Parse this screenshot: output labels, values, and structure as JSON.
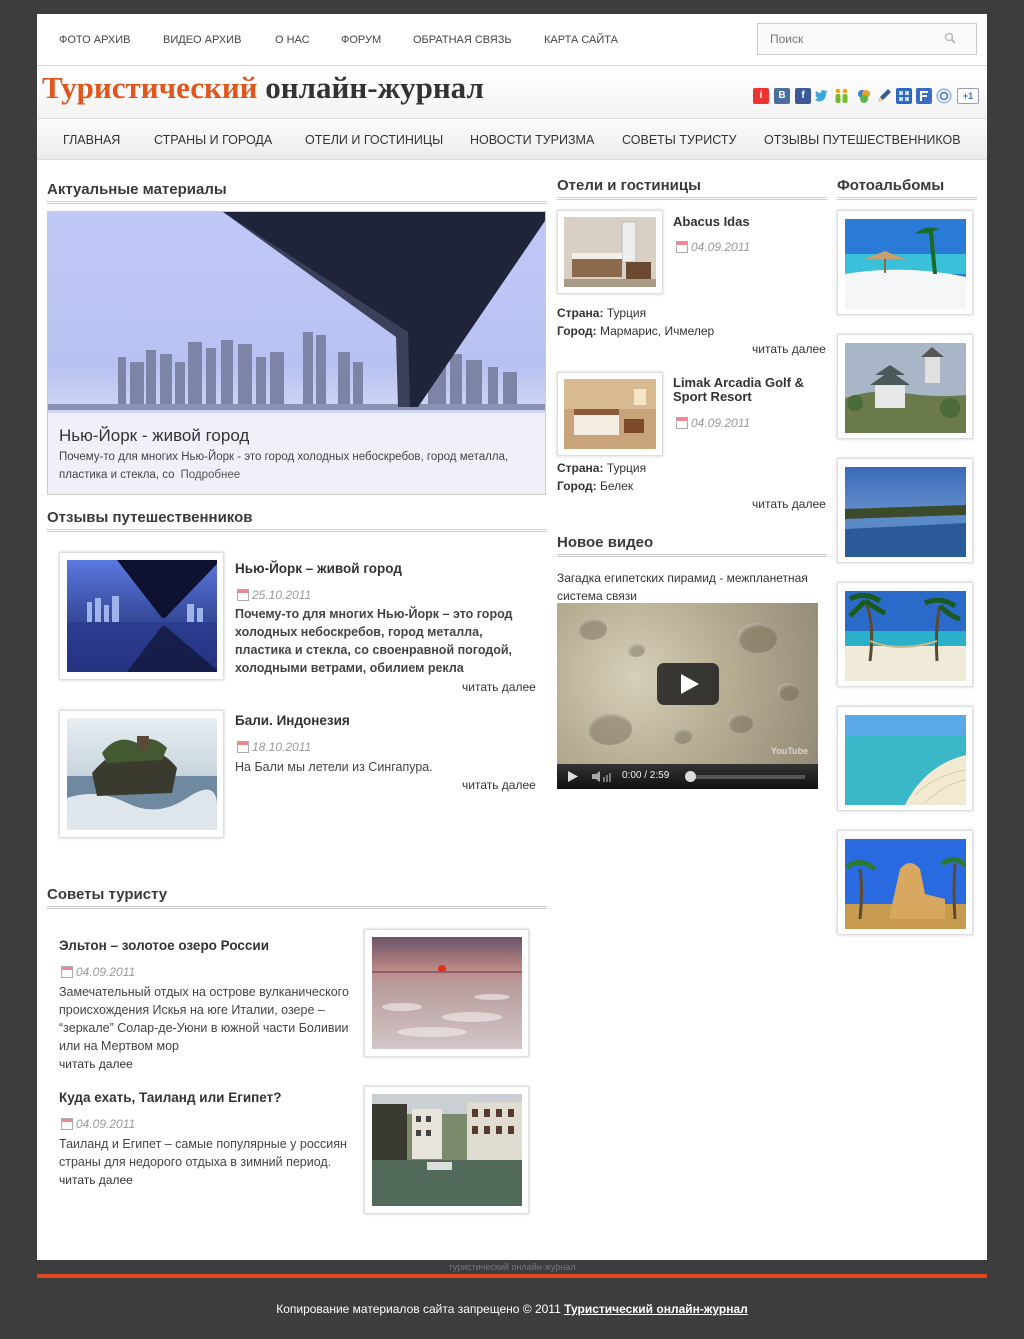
{
  "top_nav": {
    "items": [
      "ФОТО АРХИВ",
      "ВИДЕО АРХИВ",
      "О НАС",
      "ФОРУМ",
      "ОБРАТНАЯ СВЯЗЬ",
      "КАРТА САЙТА"
    ],
    "search_placeholder": "Поиск",
    "search_icon": "magnifier-icon"
  },
  "header": {
    "logo_part1": "Туристический",
    "logo_part2": "онлайн-журнал",
    "social_icons": [
      "ya-icon",
      "vkontakte-icon",
      "facebook-icon",
      "twitter-icon",
      "odnoklassniki-icon",
      "mail-icon",
      "livejournal-icon",
      "bookmarks-icon",
      "friendfeed-icon",
      "google-icon",
      "google-plus-one-icon"
    ],
    "social_labels": {
      "vk": "В",
      "fb": "f",
      "plus": "+1"
    }
  },
  "main_nav": {
    "items": [
      "ГЛАВНАЯ",
      "СТРАНЫ И ГОРОДА",
      "ОТЕЛИ И ГОСТИНИЦЫ",
      "НОВОСТИ ТУРИЗМА",
      "СОВЕТЫ ТУРИСТУ",
      "ОТЗЫВЫ ПУТЕШЕСТВЕННИКОВ"
    ]
  },
  "featured": {
    "heading": "Актуальные материалы",
    "title": "Нью-Йорк - живой город",
    "text": "Почему-то для многих Нью-Йорк - это город холодных небоскребов, город металла, пластика и стекла, со",
    "more": "Подробнее"
  },
  "reviews": {
    "heading": "Отзывы путешественников",
    "items": [
      {
        "title": "Нью-Йорк – живой город",
        "date": "25.10.2011",
        "text": "Почему-то для многих Нью-Йорк – это город холодных небоскребов, город металла, пластика и стекла, со своенравной погодой, холодными ветрами, обилием рекла",
        "more": "читать далее"
      },
      {
        "title": "Бали. Индонезия",
        "date": "18.10.2011",
        "text": "На Бали мы летели из Сингапура.",
        "more": "читать далее"
      }
    ]
  },
  "tips": {
    "heading": "Советы туристу",
    "items": [
      {
        "title": "Эльтон – золотое озеро России",
        "date": "04.09.2011",
        "text": "Замечательный отдых на острове вулканического происхождения Искья на юге Италии, озере – “зеркале” Солар-де-Уюни в южной части Боливии или на Мертвом мор",
        "more": "читать далее"
      },
      {
        "title": "Куда ехать, Таиланд или Египет?",
        "date": "04.09.2011",
        "text": "Таиланд и Египет – самые популярные у россиян страны для недорого отдыха в зимний период.",
        "more": "читать далее"
      }
    ]
  },
  "hotels": {
    "heading": "Отели и гостиницы",
    "country_label": "Страна:",
    "city_label": "Город:",
    "items": [
      {
        "title": "Abacus Idas",
        "date": "04.09.2011",
        "country": "Турция",
        "city": "Мармарис, Ичмелер",
        "more": "читать далее"
      },
      {
        "title": "Limak Arcadia Golf & Sport Resort",
        "date": "04.09.2011",
        "country": "Турция",
        "city": "Белек",
        "more": "читать далее"
      }
    ]
  },
  "video": {
    "heading": "Новое видео",
    "title": "Загадка египетских пирамид - межпланетная система связи",
    "time": "0:00 / 2:59",
    "watermark": "YouTube"
  },
  "albums": {
    "heading": "Фотоальбомы",
    "count": 6
  },
  "footer": {
    "tagline": "туристический онлайн-журнал",
    "copyright": "Копирование материалов сайта запрещено © 2011",
    "site_link": "Туристический онлайн-журнал"
  }
}
